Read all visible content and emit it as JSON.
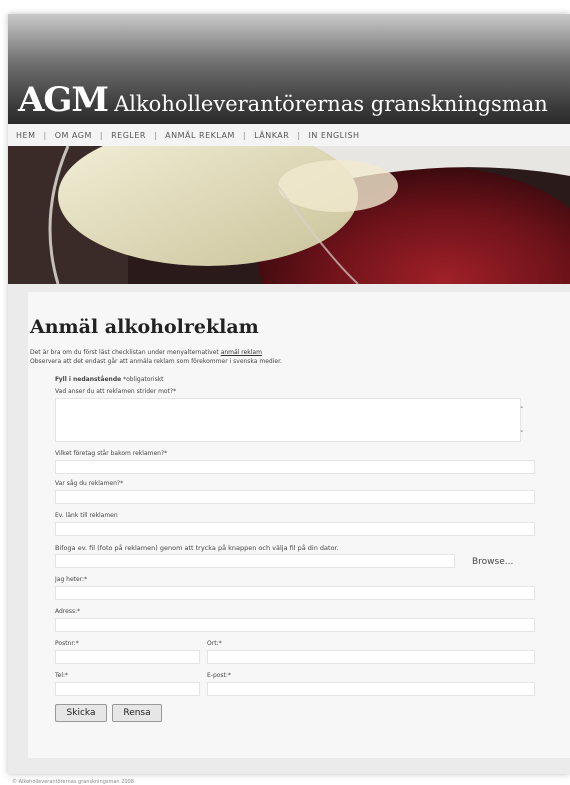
{
  "header": {
    "abbr": "AGM",
    "full_name": "Alkoholleverantörernas granskningsman"
  },
  "nav": [
    "HEM",
    "OM AGM",
    "REGLER",
    "ANMÄL REKLAM",
    "LÄNKAR",
    "IN ENGLISH"
  ],
  "form": {
    "title": "Anmäl alkoholreklam",
    "intro_line1_prefix": "Det är bra om du först läst checklistan under menyalternativet",
    "intro_link": "anmäl reklam",
    "intro_line2": "Observera att det endast går att anmäla reklam som förekommer i svenska medier.",
    "required_note_bold": "Fyll i nedanstående",
    "required_note_rest": "*obligatoriskt",
    "q1": "Vad anser du att reklamen strider mot?*",
    "q2": "Vilket företag står bakom reklamen?*",
    "q3": "Var såg du reklamen?*",
    "q4": "Ev. länk till reklamen",
    "q5": "Bifoga ev. fil (foto på reklamen) genom att trycka på knappen och välja fil på din dator.",
    "browse_label": "Browse...",
    "q6": "Jag heter:*",
    "q7": "Adress:*",
    "q8": "Postnr:*",
    "q9": "Ort:*",
    "q10": "Tel:*",
    "q11": "E-post:*",
    "submit_label": "Skicka",
    "reset_label": "Rensa"
  },
  "footer": "© Alkoholleverantörernas granskningsman 2008",
  "colors": {
    "header_dark": "#2b2b2b",
    "wine_red": "#7a1a22"
  }
}
